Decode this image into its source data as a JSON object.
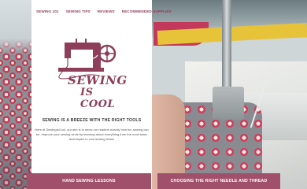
{
  "nav": {
    "items": [
      {
        "label": "Sewing 101"
      },
      {
        "label": "Sewing Tips"
      },
      {
        "label": "Reviews"
      },
      {
        "label": "Recommended Supplies"
      }
    ]
  },
  "logo": {
    "line1": "SEWING",
    "line2": "IS COOL"
  },
  "hero": {
    "tagline": "Sewing is a breeze with the right tools",
    "intro": "Here at SewingIsCool, our aim is to show our readers exactly how fun sewing can be. Improve your sewing circle by learning about everything from the most basic techniques to cool sewing tricks!"
  },
  "cards": {
    "left_label": "Hand Sewing Lessons",
    "right_label": "Choosing the Right Needle and Thread"
  },
  "colors": {
    "brand": "#8d3e58",
    "button": "#a0506a",
    "panel": "#ffffff"
  }
}
